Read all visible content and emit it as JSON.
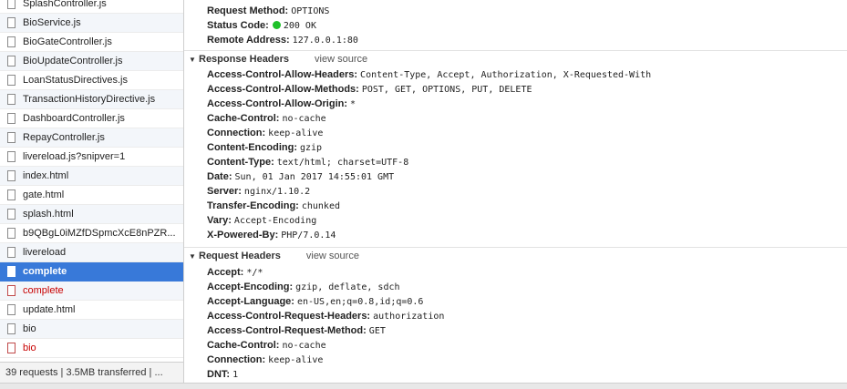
{
  "files": [
    {
      "name": "SplashController.js",
      "state": "normal"
    },
    {
      "name": "BioService.js",
      "state": "normal"
    },
    {
      "name": "BioGateController.js",
      "state": "normal"
    },
    {
      "name": "BioUpdateController.js",
      "state": "normal"
    },
    {
      "name": "LoanStatusDirectives.js",
      "state": "normal"
    },
    {
      "name": "TransactionHistoryDirective.js",
      "state": "normal"
    },
    {
      "name": "DashboardController.js",
      "state": "normal"
    },
    {
      "name": "RepayController.js",
      "state": "normal"
    },
    {
      "name": "livereload.js?snipver=1",
      "state": "normal"
    },
    {
      "name": "index.html",
      "state": "normal"
    },
    {
      "name": "gate.html",
      "state": "normal"
    },
    {
      "name": "splash.html",
      "state": "normal"
    },
    {
      "name": "b9QBgL0iMZfDSpmcXcE8nPZR...",
      "state": "normal"
    },
    {
      "name": "livereload",
      "state": "normal"
    },
    {
      "name": "complete",
      "state": "selected"
    },
    {
      "name": "complete",
      "state": "error"
    },
    {
      "name": "update.html",
      "state": "normal"
    },
    {
      "name": "bio",
      "state": "normal"
    },
    {
      "name": "bio",
      "state": "error"
    }
  ],
  "status_bar": "39 requests | 3.5MB transferred | ...",
  "general": [
    {
      "key": "Request Method:",
      "value": "OPTIONS"
    },
    {
      "key": "Status Code:",
      "value": "200 OK",
      "dot": true
    },
    {
      "key": "Remote Address:",
      "value": "127.0.0.1:80"
    }
  ],
  "response_headers": {
    "title": "Response Headers",
    "view_source": "view source",
    "items": [
      {
        "key": "Access-Control-Allow-Headers:",
        "value": "Content-Type, Accept, Authorization, X-Requested-With"
      },
      {
        "key": "Access-Control-Allow-Methods:",
        "value": "POST, GET, OPTIONS, PUT, DELETE"
      },
      {
        "key": "Access-Control-Allow-Origin:",
        "value": "*"
      },
      {
        "key": "Cache-Control:",
        "value": "no-cache"
      },
      {
        "key": "Connection:",
        "value": "keep-alive"
      },
      {
        "key": "Content-Encoding:",
        "value": "gzip"
      },
      {
        "key": "Content-Type:",
        "value": "text/html; charset=UTF-8"
      },
      {
        "key": "Date:",
        "value": "Sun, 01 Jan 2017 14:55:01 GMT"
      },
      {
        "key": "Server:",
        "value": "nginx/1.10.2"
      },
      {
        "key": "Transfer-Encoding:",
        "value": "chunked"
      },
      {
        "key": "Vary:",
        "value": "Accept-Encoding"
      },
      {
        "key": "X-Powered-By:",
        "value": "PHP/7.0.14"
      }
    ]
  },
  "request_headers": {
    "title": "Request Headers",
    "view_source": "view source",
    "items": [
      {
        "key": "Accept:",
        "value": "*/*"
      },
      {
        "key": "Accept-Encoding:",
        "value": "gzip, deflate, sdch"
      },
      {
        "key": "Accept-Language:",
        "value": "en-US,en;q=0.8,id;q=0.6"
      },
      {
        "key": "Access-Control-Request-Headers:",
        "value": "authorization"
      },
      {
        "key": "Access-Control-Request-Method:",
        "value": "GET"
      },
      {
        "key": "Cache-Control:",
        "value": "no-cache"
      },
      {
        "key": "Connection:",
        "value": "keep-alive"
      },
      {
        "key": "DNT:",
        "value": "1"
      }
    ]
  },
  "colors": {
    "selected": "#3879d9",
    "error_text": "#c80000",
    "status_ok": "#1fc12a"
  },
  "icons": {
    "file": "file-icon",
    "disclosure": "triangle-down-icon",
    "status": "status-dot-icon"
  }
}
